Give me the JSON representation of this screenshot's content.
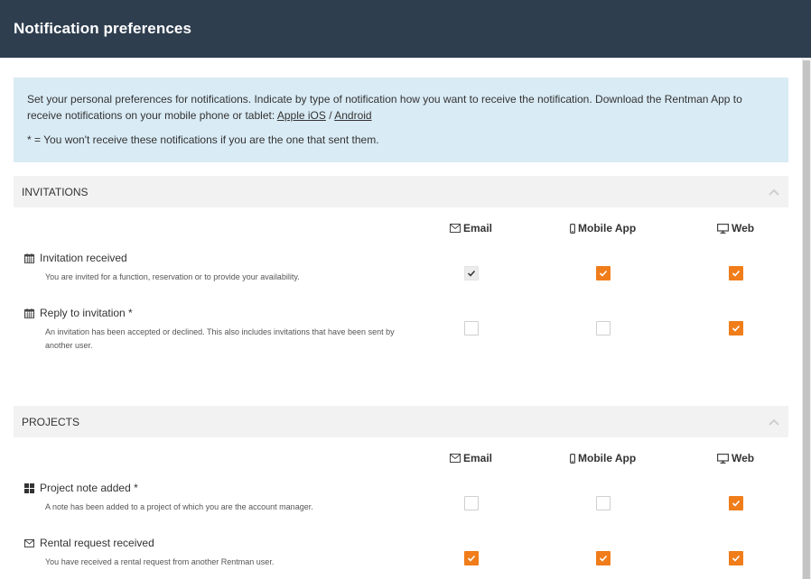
{
  "title": "Notification preferences",
  "info": {
    "text": "Set your personal preferences for notifications. Indicate by type of notification how you want to receive the notification. Download the Rentman App to receive notifications on your mobile phone or tablet: ",
    "link_ios": "Apple iOS",
    "separator": " / ",
    "link_android": "Android",
    "note": "* = You won't receive these notifications if you are the one that sent them."
  },
  "columns": {
    "email": "Email",
    "mobile": "Mobile App",
    "web": "Web"
  },
  "sections": [
    {
      "title": "INVITATIONS",
      "rows": [
        {
          "icon": "calendar-icon",
          "title": "Invitation received",
          "desc": "You are invited for a function, reservation or to provide your availability.",
          "email": "checked-disabled",
          "mobile": "checked",
          "web": "checked"
        },
        {
          "icon": "calendar-icon",
          "title": "Reply to invitation *",
          "desc": "An invitation has been accepted or declined. This also includes invitations that have been sent by another user.",
          "email": "unchecked",
          "mobile": "unchecked",
          "web": "checked"
        }
      ]
    },
    {
      "title": "PROJECTS",
      "rows": [
        {
          "icon": "grid-icon",
          "title": "Project note added *",
          "desc": "A note has been added to a project of which you are the account manager.",
          "email": "unchecked",
          "mobile": "unchecked",
          "web": "checked"
        },
        {
          "icon": "envelope-icon",
          "title": "Rental request received",
          "desc": "You have received a rental request from another Rentman user.",
          "email": "checked",
          "mobile": "checked",
          "web": "checked"
        }
      ]
    }
  ],
  "colors": {
    "header_bg": "#2e3e4f",
    "info_bg": "#d9ebf5",
    "section_bg": "#f2f2f2",
    "accent": "#f07d1a"
  }
}
